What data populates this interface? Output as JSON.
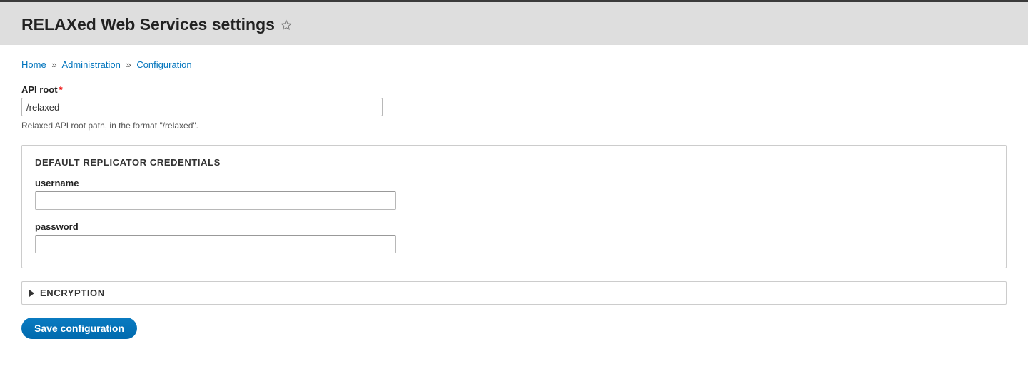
{
  "header": {
    "title": "RELAXed Web Services settings"
  },
  "breadcrumb": {
    "home": "Home",
    "administration": "Administration",
    "configuration": "Configuration",
    "separator": "»"
  },
  "form": {
    "api_root": {
      "label": "API root",
      "value": "/relaxed",
      "description": "Relaxed API root path, in the format \"/relaxed\"."
    },
    "credentials": {
      "legend": "DEFAULT REPLICATOR CREDENTIALS",
      "username_label": "username",
      "username_value": "",
      "password_label": "password",
      "password_value": ""
    },
    "encryption": {
      "summary": "ENCRYPTION"
    },
    "submit_label": "Save configuration"
  }
}
